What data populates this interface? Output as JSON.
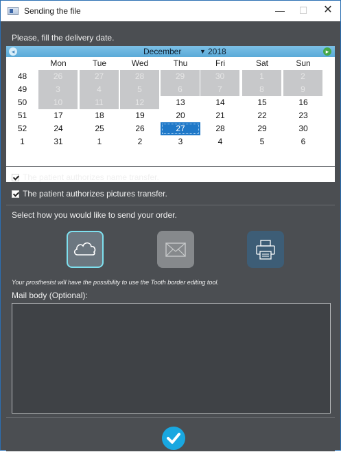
{
  "window": {
    "title": "Sending the file",
    "minimize_label": "—",
    "maximize_label": "☐",
    "close_label": "✕"
  },
  "delivery": {
    "prompt": "Please, fill the delivery date."
  },
  "calendar": {
    "month": "December",
    "year": "2018",
    "weekdays": [
      "Mon",
      "Tue",
      "Wed",
      "Thu",
      "Fri",
      "Sat",
      "Sun"
    ],
    "weeks": [
      {
        "week": "48",
        "days": [
          "26",
          "27",
          "28",
          "29",
          "30",
          "1",
          "2"
        ],
        "other": [
          true,
          true,
          true,
          true,
          true,
          true,
          true
        ]
      },
      {
        "week": "49",
        "days": [
          "3",
          "4",
          "5",
          "6",
          "7",
          "8",
          "9"
        ],
        "other": [
          true,
          true,
          true,
          true,
          true,
          true,
          true
        ]
      },
      {
        "week": "50",
        "days": [
          "10",
          "11",
          "12",
          "13",
          "14",
          "15",
          "16"
        ],
        "other": [
          true,
          true,
          true,
          false,
          false,
          false,
          false
        ]
      },
      {
        "week": "51",
        "days": [
          "17",
          "18",
          "19",
          "20",
          "21",
          "22",
          "23"
        ],
        "other": [
          false,
          false,
          false,
          false,
          false,
          false,
          false
        ]
      },
      {
        "week": "52",
        "days": [
          "24",
          "25",
          "26",
          "27",
          "28",
          "29",
          "30"
        ],
        "other": [
          false,
          false,
          false,
          false,
          false,
          false,
          false
        ]
      },
      {
        "week": "1",
        "days": [
          "31",
          "1",
          "2",
          "3",
          "4",
          "5",
          "6"
        ],
        "other": [
          false,
          false,
          false,
          false,
          false,
          false,
          false
        ]
      }
    ],
    "selected": "27",
    "accent": "#1f78c8"
  },
  "consents": {
    "name_transfer": "The patient authorizes name transfer.",
    "pictures_transfer": "The patient authorizes pictures transfer."
  },
  "send": {
    "prompt": "Select how you would like to send your order.",
    "options": [
      {
        "icon": "cloud-icon",
        "selected": true
      },
      {
        "icon": "mail-icon",
        "selected": false
      },
      {
        "icon": "printer-icon",
        "selected": false
      }
    ],
    "hint": "Your prosthesist will have the possibility to use the Tooth border editing tool."
  },
  "mail": {
    "label": "Mail body (Optional):",
    "value": ""
  },
  "confirm": {
    "icon": "checkmark-icon",
    "color": "#19a7e0"
  }
}
